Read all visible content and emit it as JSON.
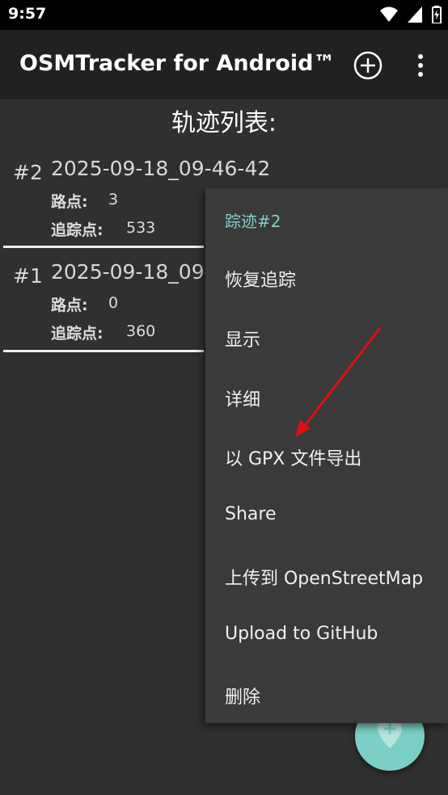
{
  "status_bar": {
    "time": "9:57"
  },
  "app_bar": {
    "title": "OSMTracker for Android™"
  },
  "list": {
    "title": "轨迹列表:",
    "tracks": [
      {
        "id": "#2",
        "name": "2025-09-18_09-46-42",
        "waypoints_label": "路点:",
        "waypoints": "3",
        "trackpoints_label": "追踪点:",
        "trackpoints": "533"
      },
      {
        "id": "#1",
        "name": "2025-09-18_09-",
        "waypoints_label": "路点:",
        "waypoints": "0",
        "trackpoints_label": "追踪点:",
        "trackpoints": "360"
      }
    ]
  },
  "context_menu": {
    "header": "踪迹#2",
    "items": [
      "恢复追踪",
      "显示",
      "详细",
      "以 GPX 文件导出",
      "Share",
      "上传到 OpenStreetMap",
      "Upload to GitHub",
      "删除"
    ]
  },
  "colors": {
    "accent": "#7bcfc6",
    "annotation_arrow": "#e01010"
  },
  "icons": [
    "wifi-icon",
    "signal-icon",
    "battery-icon",
    "add-circle-icon",
    "overflow-menu-icon",
    "add-location-icon"
  ]
}
